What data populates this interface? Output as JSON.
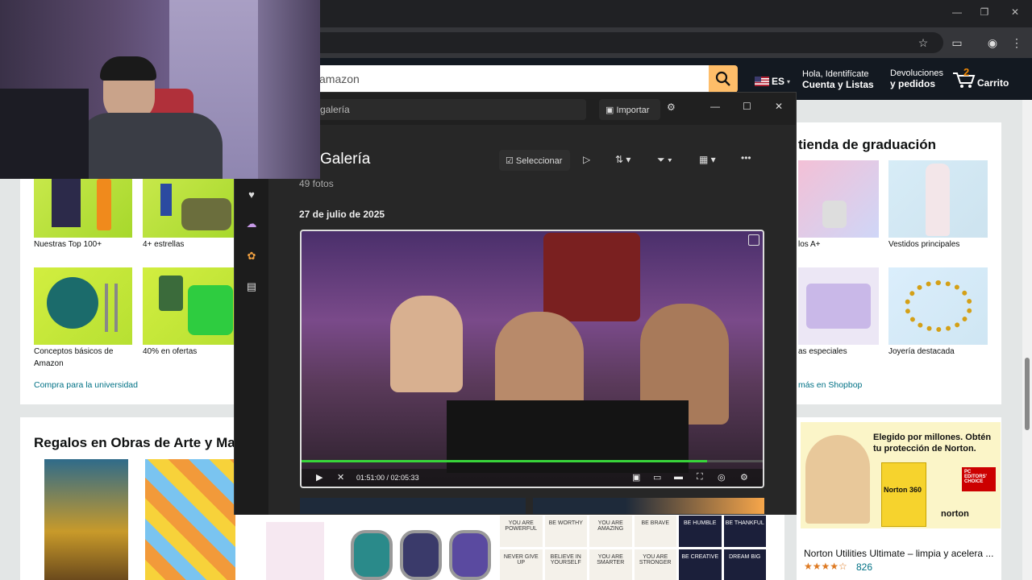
{
  "browser": {
    "window_min": "—",
    "window_max": "❐",
    "window_close": "✕"
  },
  "amazon": {
    "search_text": "amazon",
    "lang": "ES",
    "account_line1": "Hola, Identifícate",
    "account_line2": "Cuenta y Listas",
    "returns_line1": "Devoluciones",
    "returns_line2": "y pedidos",
    "cart_count": "2",
    "cart_label": "Carrito",
    "left_card": {
      "tiles": [
        "Nuestras Top 100+",
        "4+ estrellas",
        "Conceptos básicos de Amazon",
        "40% en ofertas"
      ],
      "link": "Compra para la universidad"
    },
    "right_card": {
      "title": "tienda de graduación",
      "tiles": [
        "los A+",
        "Vestidos principales",
        "as especiales",
        "Joyería destacada"
      ],
      "link": "más en Shopbop"
    },
    "art_card": {
      "title": "Regalos en Obras de Arte y Ma"
    },
    "norton": {
      "headline": "Elegido por millones. Obtén tu protección de Norton.",
      "badge": "PC EDITORS' CHOICE",
      "product": "Norton 360",
      "brand": "norton",
      "title": "Norton Utilities Ultimate – limpia y acelera ...",
      "stars": "★★★★☆",
      "reviews": "826"
    },
    "posters": [
      "YOU ARE POWERFUL",
      "BE WORTHY",
      "YOU ARE AMAZING",
      "BE BRAVE",
      "BE HUMBLE",
      "BE THANKFUL",
      "NEVER GIVE UP",
      "BELIEVE IN YOURSELF",
      "YOU ARE SMARTER",
      "YOU ARE STRONGER",
      "BE CREATIVE",
      "DREAM BIG"
    ]
  },
  "gallery": {
    "search_placeholder": "a galería",
    "import_label": "Importar",
    "title": "Galería",
    "count": "49 fotos",
    "select_label": "Seleccionar",
    "date_header": "27 de julio de 2025",
    "video": {
      "time": "01:51:00 / 02:05:33",
      "progress": 0.88
    }
  }
}
